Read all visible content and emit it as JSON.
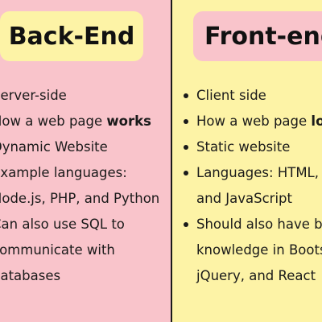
{
  "left": {
    "title": "Back-End",
    "items": [
      {
        "text": "Server-side"
      },
      {
        "text": "How a web page ",
        "bold": "works"
      },
      {
        "text": "Dynamic Website"
      },
      {
        "text": "Example languages:",
        "cont": "Node.js, PHP, and Python"
      },
      {
        "text": "Can also use SQL to",
        "cont": "communicate with",
        "cont2": "databases"
      }
    ]
  },
  "right": {
    "title": "Front-end",
    "items": [
      {
        "text": "Client side"
      },
      {
        "text": "How a web page ",
        "bold": "looks"
      },
      {
        "text": "Static website"
      },
      {
        "text": "Languages: HTML, CSS,",
        "cont": "and JavaScript"
      },
      {
        "text": "Should also have basic",
        "cont": "knowledge in Bootstrap,",
        "cont2": "jQuery, and React"
      }
    ]
  },
  "colors": {
    "pink": "#f9c4cb",
    "yellow": "#fdf3a6",
    "divider": "#1a1a1a"
  }
}
